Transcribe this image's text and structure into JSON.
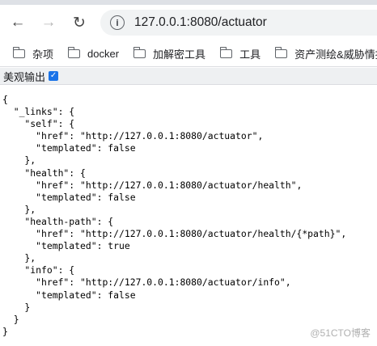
{
  "browser": {
    "url": "127.0.0.1:8080/actuator",
    "icons": {
      "back": "back-arrow-icon",
      "forward": "forward-arrow-icon",
      "reload": "reload-icon",
      "info": "site-info-icon"
    }
  },
  "bookmarks": [
    {
      "label": "杂项"
    },
    {
      "label": "docker"
    },
    {
      "label": "加解密工具"
    },
    {
      "label": "工具"
    },
    {
      "label": "资产测绘&威胁情报"
    }
  ],
  "viewer": {
    "pretty_label": "美观输出",
    "pretty_checked": true
  },
  "json_text": "{\n  \"_links\": {\n    \"self\": {\n      \"href\": \"http://127.0.0.1:8080/actuator\",\n      \"templated\": false\n    },\n    \"health\": {\n      \"href\": \"http://127.0.0.1:8080/actuator/health\",\n      \"templated\": false\n    },\n    \"health-path\": {\n      \"href\": \"http://127.0.0.1:8080/actuator/health/{*path}\",\n      \"templated\": true\n    },\n    \"info\": {\n      \"href\": \"http://127.0.0.1:8080/actuator/info\",\n      \"templated\": false\n    }\n  }\n}",
  "watermark": "@51CTO博客"
}
